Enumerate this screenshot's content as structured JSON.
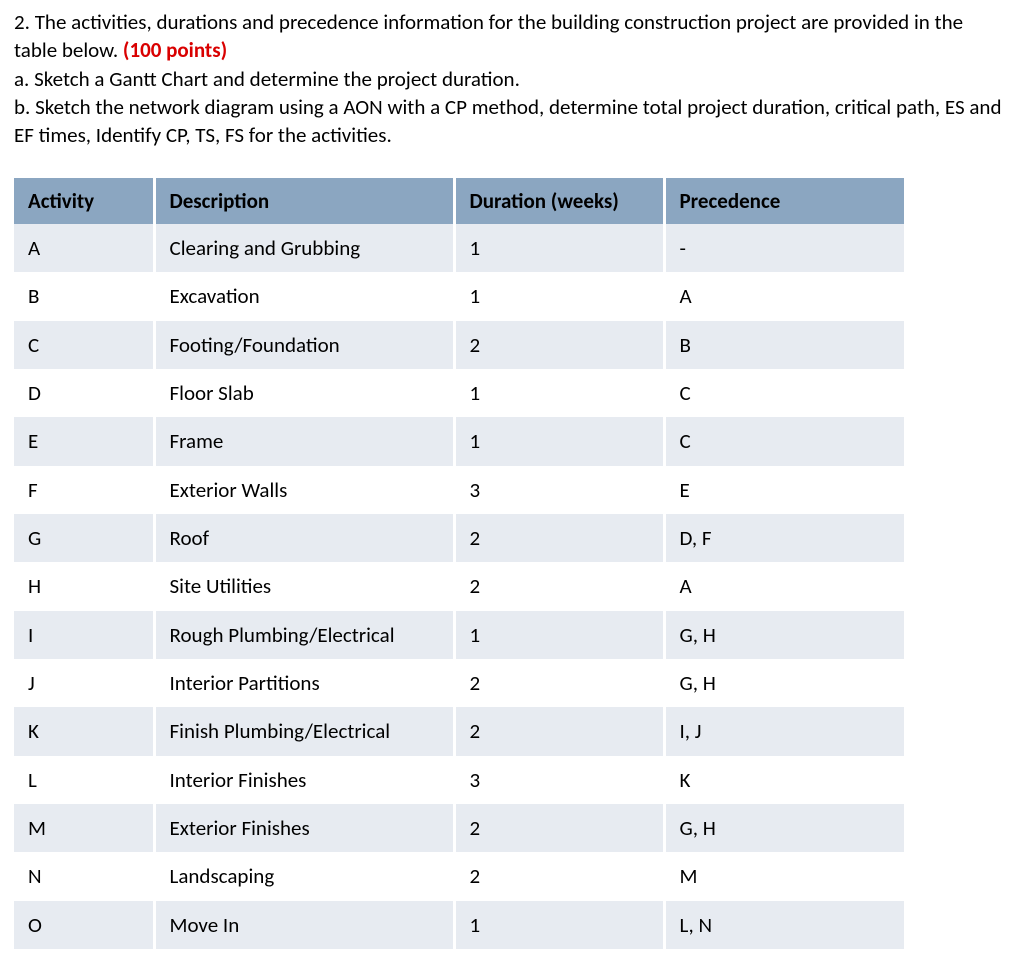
{
  "question": {
    "intro": "2. The activities, durations and precedence information for the building construction project are provided in the table below. ",
    "points": "(100 points)",
    "part_a": "a. Sketch a Gantt Chart and determine the project duration.",
    "part_b": "b. Sketch the network diagram using a AON with a CP method, determine total project duration, critical path, ES and EF times, Identify CP, TS, FS for the activities."
  },
  "table": {
    "headers": {
      "activity": "Activity",
      "description": "Description",
      "duration": "Duration (weeks)",
      "precedence": "Precedence"
    },
    "rows": [
      {
        "activity": "A",
        "description": "Clearing and Grubbing",
        "duration": "1",
        "precedence": "-"
      },
      {
        "activity": "B",
        "description": "Excavation",
        "duration": "1",
        "precedence": "A"
      },
      {
        "activity": "C",
        "description": "Footing/Foundation",
        "duration": "2",
        "precedence": "B"
      },
      {
        "activity": "D",
        "description": "Floor Slab",
        "duration": "1",
        "precedence": "C"
      },
      {
        "activity": "E",
        "description": "Frame",
        "duration": "1",
        "precedence": "C"
      },
      {
        "activity": "F",
        "description": "Exterior Walls",
        "duration": "3",
        "precedence": "E"
      },
      {
        "activity": "G",
        "description": "Roof",
        "duration": "2",
        "precedence": "D, F"
      },
      {
        "activity": "H",
        "description": "Site Utilities",
        "duration": "2",
        "precedence": "A"
      },
      {
        "activity": "I",
        "description": "Rough Plumbing/Electrical",
        "duration": "1",
        "precedence": "G, H"
      },
      {
        "activity": "J",
        "description": "Interior Partitions",
        "duration": "2",
        "precedence": "G, H"
      },
      {
        "activity": "K",
        "description": "Finish Plumbing/Electrical",
        "duration": "2",
        "precedence": "I, J"
      },
      {
        "activity": "L",
        "description": "Interior Finishes",
        "duration": "3",
        "precedence": "K"
      },
      {
        "activity": "M",
        "description": "Exterior Finishes",
        "duration": "2",
        "precedence": "G, H"
      },
      {
        "activity": "N",
        "description": "Landscaping",
        "duration": "2",
        "precedence": "M"
      },
      {
        "activity": "O",
        "description": "Move In",
        "duration": "1",
        "precedence": "L, N"
      }
    ]
  }
}
